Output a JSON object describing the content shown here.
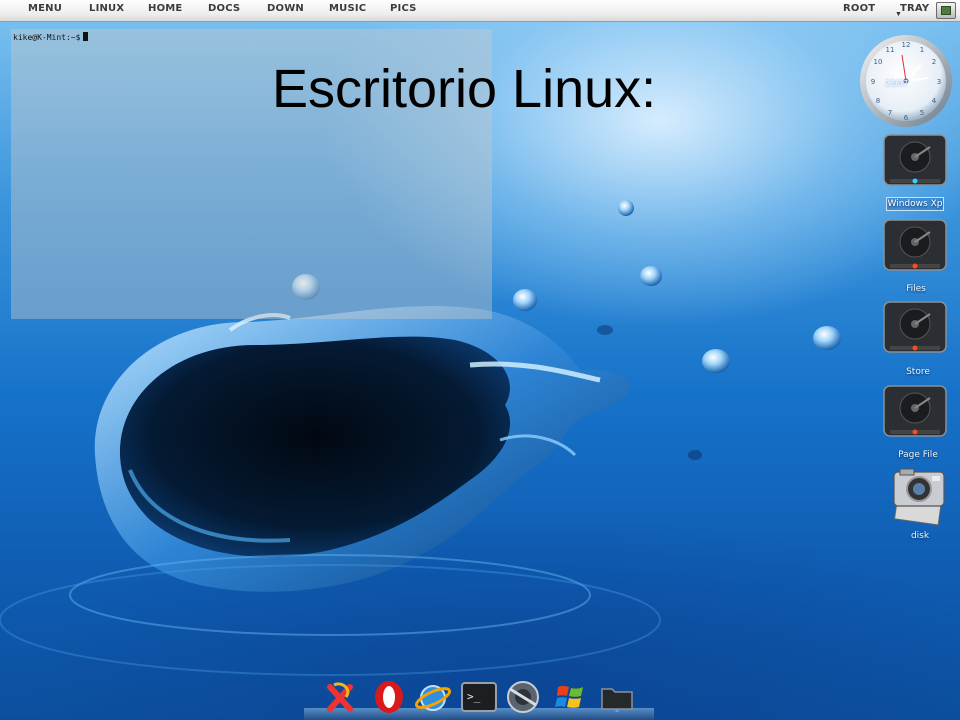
{
  "menubar": {
    "left": [
      "MENU",
      "LINUX",
      "HOME",
      "DOCS",
      "DOWN",
      "MUSIC",
      "PICS"
    ],
    "right": [
      "ROOT",
      "TRAY"
    ]
  },
  "terminal": {
    "prompt": "kike@K-Mint:~$"
  },
  "slide": {
    "title": "Escritorio Linux:"
  },
  "clock": {
    "date": "23/07",
    "numerals": [
      "12",
      "1",
      "2",
      "3",
      "4",
      "5",
      "6",
      "7",
      "8",
      "9",
      "10",
      "11"
    ]
  },
  "desktop_icons": [
    {
      "label": "Windows Xp",
      "icon": "hard-drive-icon"
    },
    {
      "label": "Files",
      "icon": "hard-drive-icon"
    },
    {
      "label": "Store",
      "icon": "hard-drive-icon"
    },
    {
      "label": "Page File",
      "icon": "hard-drive-icon"
    },
    {
      "label": "disk",
      "icon": "camera-drive-icon"
    }
  ],
  "dock": {
    "items": [
      "graphics-app-icon",
      "opera-browser-icon",
      "web-browser-icon",
      "terminal-icon",
      "media-player-icon",
      "windows-logo-icon",
      "folder-icon"
    ]
  },
  "colors": {
    "sky_top": "#7fc4f2",
    "sea_deep": "#0c4f9e",
    "menubar": "#ececec"
  }
}
